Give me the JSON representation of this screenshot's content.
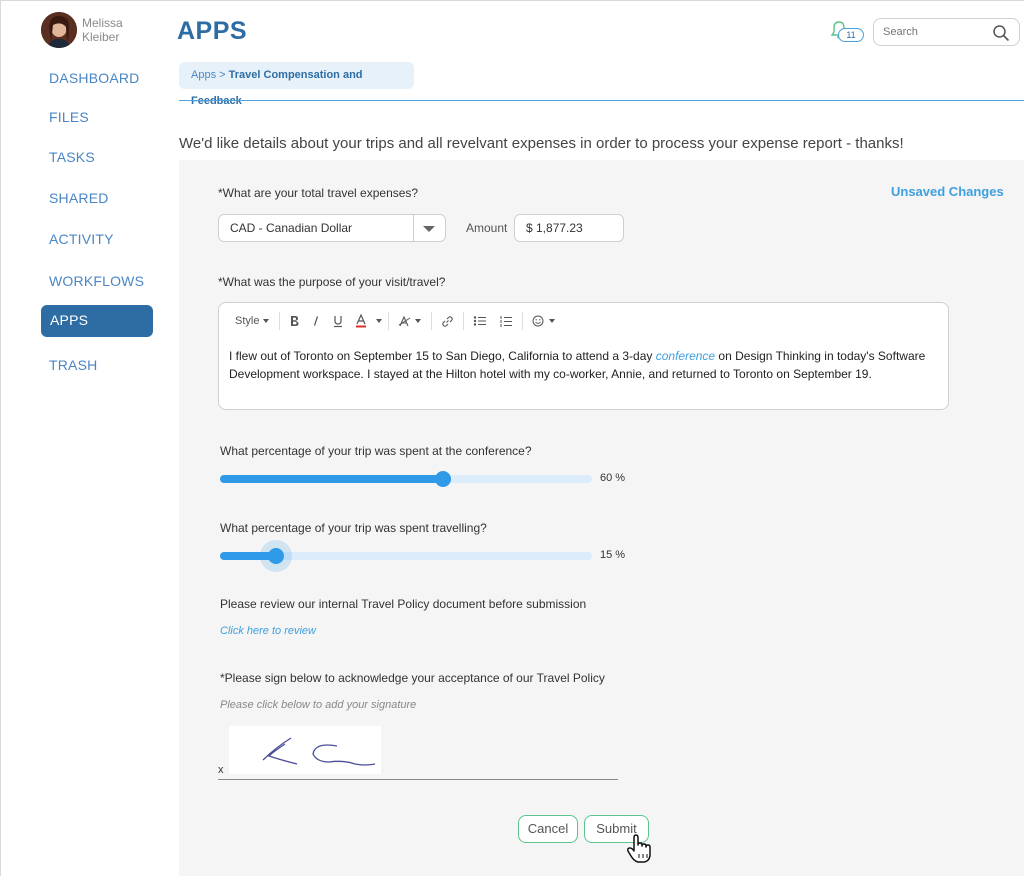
{
  "user": {
    "first_name": "Melissa",
    "last_name": "Kleiber"
  },
  "nav": {
    "items": [
      {
        "label": "DASHBOARD"
      },
      {
        "label": "FILES"
      },
      {
        "label": "TASKS"
      },
      {
        "label": "SHARED"
      },
      {
        "label": "ACTIVITY"
      },
      {
        "label": "WORKFLOWS"
      },
      {
        "label": "APPS"
      },
      {
        "label": "TRASH"
      }
    ],
    "active": "APPS"
  },
  "header": {
    "title": "APPS",
    "notification_count": "11",
    "search_placeholder": "Search"
  },
  "breadcrumb": {
    "root": "Apps",
    "separator": ">",
    "current": "Travel Compensation and Feedback"
  },
  "intro": "We'd like details about your trips and all revelvant expenses in order to process your expense report - thanks!",
  "form": {
    "unsaved": "Unsaved Changes",
    "q_expenses": "*What are your total travel expenses?",
    "currency": "CAD - Canadian Dollar",
    "amount_label": "Amount",
    "amount_value": "$ 1,877.23",
    "q_purpose": "*What was the purpose of your visit/travel?",
    "toolbar": {
      "style": "Style"
    },
    "purpose_text": {
      "before": "I flew out of Toronto on September 15 to San Diego, California to attend a 3-day ",
      "link": "conference",
      "after": " on Design Thinking in today's Software Development workspace. I stayed at the Hilton hotel with my co-worker, Annie, and returned to Toronto on September 19."
    },
    "q_conference": "What percentage of your trip was spent at the conference?",
    "conference_pct": 60,
    "conference_pct_label": "60 %",
    "q_travelling": "What percentage of your trip was spent travelling?",
    "travelling_pct": 15,
    "travelling_pct_label": "15 %",
    "policy_text": "Please review our internal Travel Policy document before submission",
    "policy_link": "Click here to review",
    "sign_label": "*Please sign below to acknowledge your acceptance of our Travel Policy",
    "sign_hint": "Please click below to add your signature",
    "sign_x": "x",
    "cancel": "Cancel",
    "submit": "Submit"
  },
  "colors": {
    "primary": "#2e6da4",
    "accent": "#3da0e0",
    "slider": "#2f9ae8",
    "button_border": "#5cc48a"
  }
}
